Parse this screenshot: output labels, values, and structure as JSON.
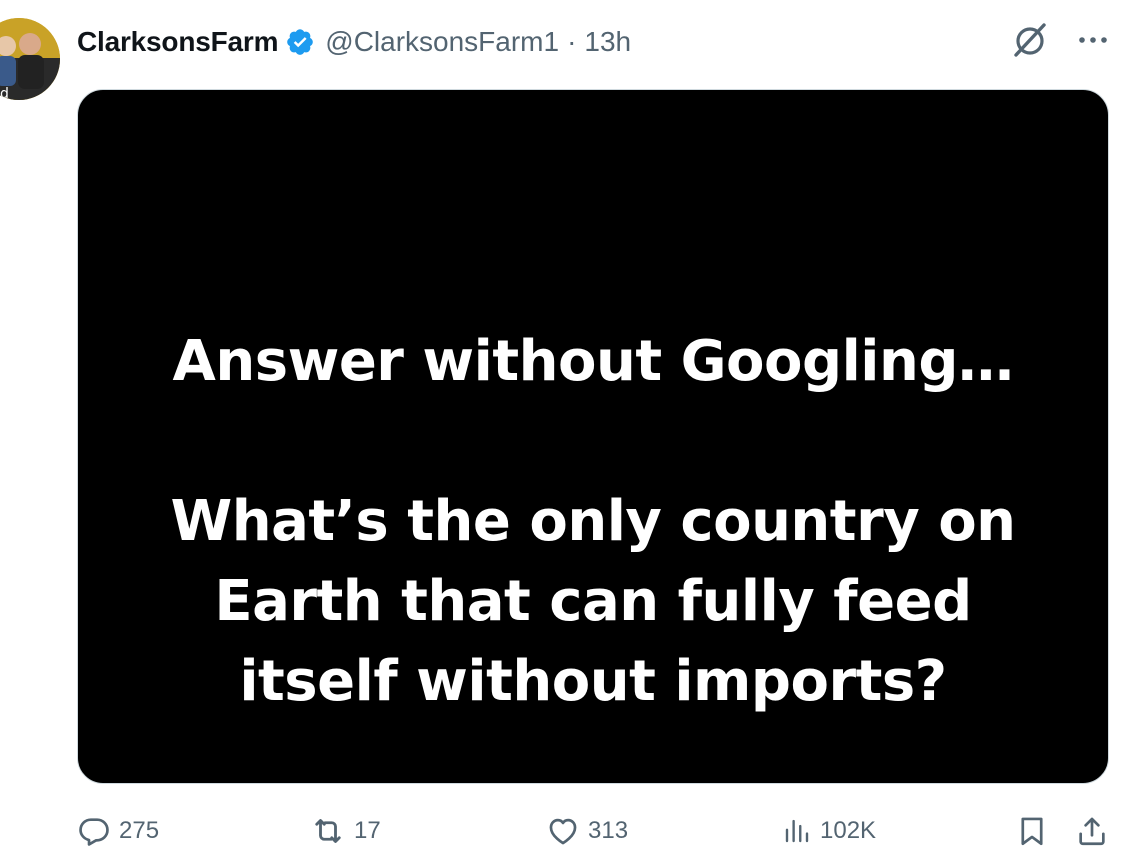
{
  "tweet": {
    "display_name": "ClarksonsFarm",
    "handle": "@ClarksonsFarm1",
    "separator": "·",
    "time": "13h",
    "media": {
      "headline": "Answer without Googling…",
      "question_line_1": "What’s the only country on",
      "question_line_2": "Earth that can fully feed",
      "question_line_3": "itself without imports?"
    },
    "actions": {
      "replies": "275",
      "reposts": "17",
      "likes": "313",
      "views": "102K"
    }
  },
  "icons": {
    "verified": "verified-badge-icon",
    "grok": "grok-icon",
    "more": "more-icon",
    "reply": "reply-icon",
    "repost": "repost-icon",
    "like": "heart-icon",
    "views": "analytics-icon",
    "bookmark": "bookmark-icon",
    "share": "share-icon"
  },
  "colors": {
    "text": "#0f1419",
    "secondary": "#536471",
    "verified": "#1d9bf0",
    "media_bg": "#000000"
  }
}
